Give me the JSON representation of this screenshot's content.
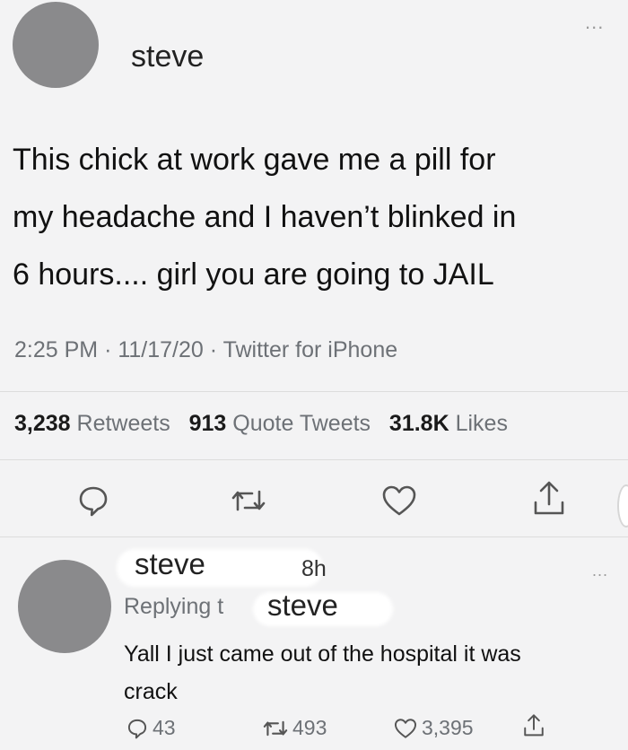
{
  "tweet": {
    "username": "steve",
    "more": "...",
    "text_lines": [
      "This chick at work gave me a pill for",
      "my headache and I haven’t blinked in",
      "6 hours.... girl you are going to JAIL"
    ],
    "time": "2:25 PM",
    "date": "11/17/20",
    "separator": "·",
    "source": "Twitter for iPhone",
    "stats": {
      "retweets_count": "3,238",
      "retweets_label": "Retweets",
      "quotes_count": "913",
      "quotes_label": "Quote Tweets",
      "likes_count": "31.8K",
      "likes_label": "Likes"
    },
    "actions": [
      "reply-icon",
      "retweet-icon",
      "like-icon",
      "share-icon"
    ]
  },
  "reply": {
    "username": "steve",
    "time": "8h",
    "more": "...",
    "replying_prefix": "Replying t",
    "replying_to": "steve",
    "text_lines": [
      "Yall I just came out of the hospital it was",
      "crack"
    ],
    "actions": {
      "replies": "43",
      "retweets": "493",
      "likes": "3,395"
    }
  },
  "colors": {
    "background": "#f3f3f4",
    "muted": "#6d7176",
    "avatar": "#8a8a8c"
  }
}
